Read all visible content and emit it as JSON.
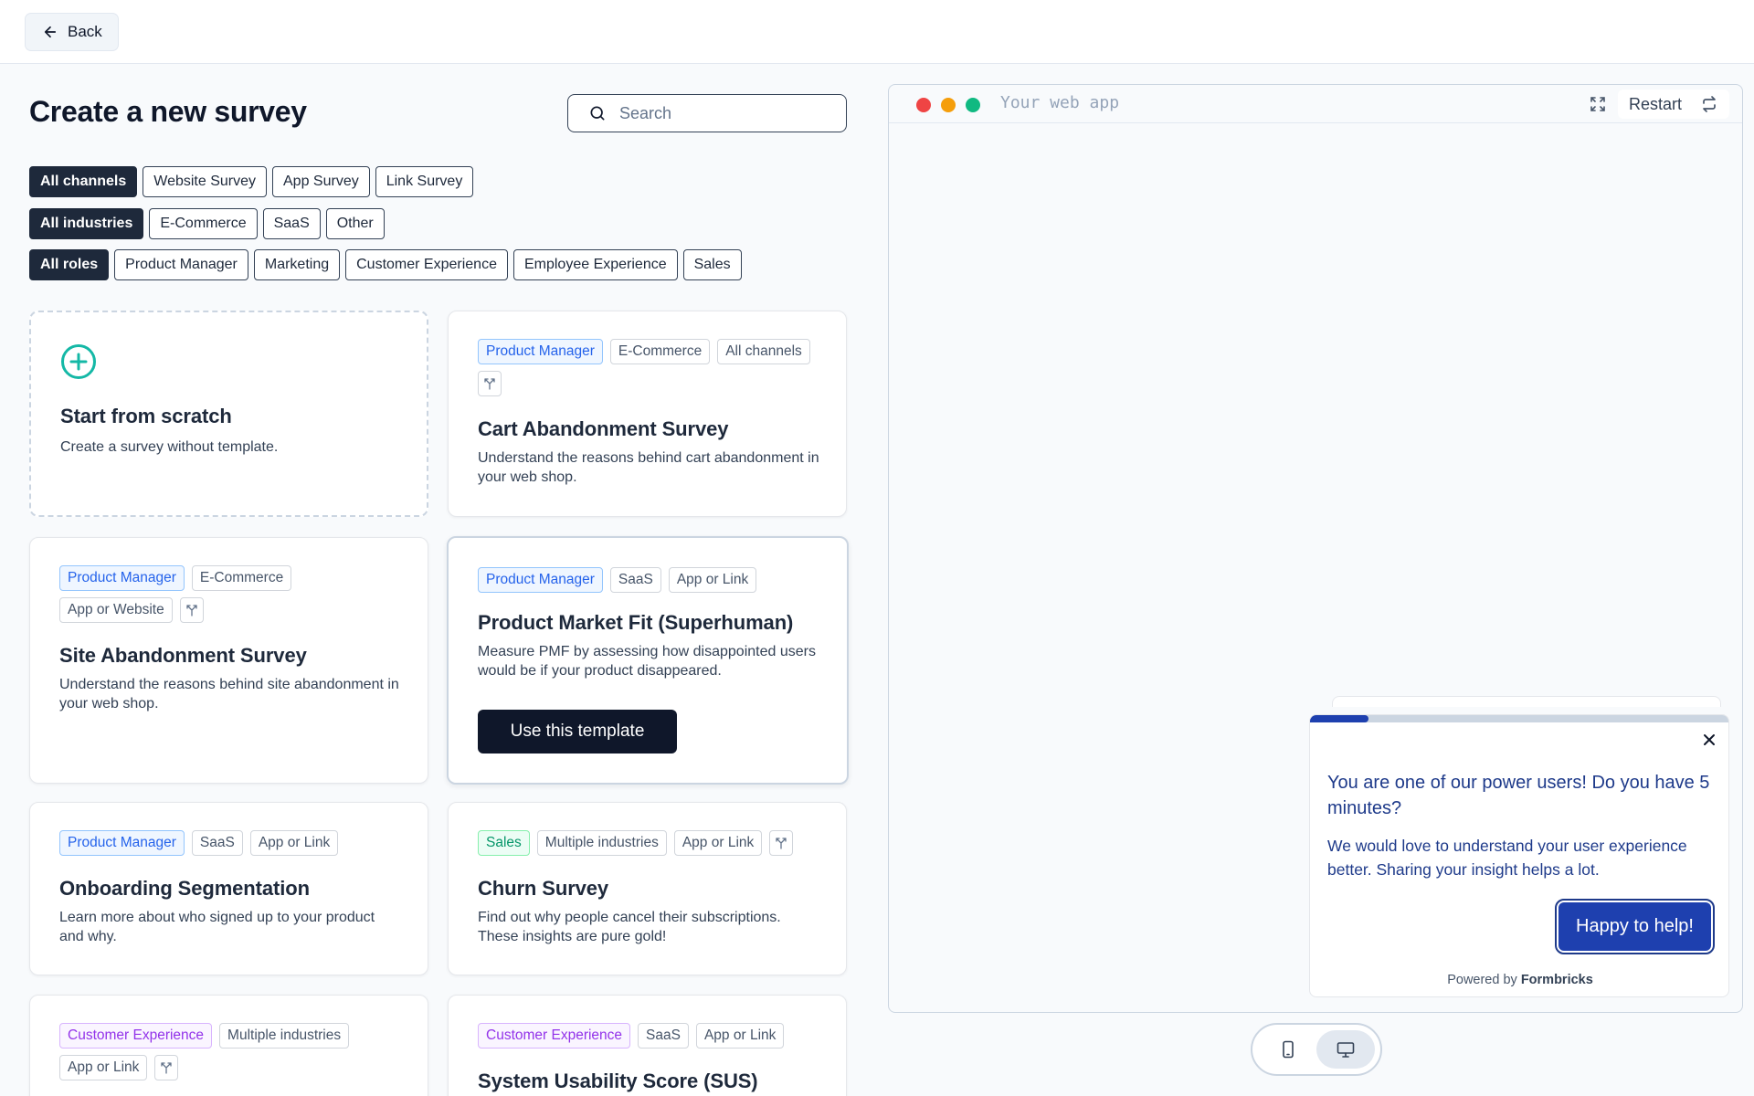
{
  "topbar": {
    "back_label": "Back"
  },
  "header": {
    "title": "Create a new survey",
    "search_placeholder": "Search"
  },
  "filters": {
    "channels": [
      "All channels",
      "Website Survey",
      "App Survey",
      "Link Survey"
    ],
    "industries": [
      "All industries",
      "E-Commerce",
      "SaaS",
      "Other"
    ],
    "roles": [
      "All roles",
      "Product Manager",
      "Marketing",
      "Customer Experience",
      "Employee Experience",
      "Sales"
    ]
  },
  "scratch": {
    "title": "Start from scratch",
    "description": "Create a survey without template."
  },
  "templates": [
    {
      "tags": [
        "Product Manager",
        "E-Commerce",
        "All channels"
      ],
      "title": "Cart Abandonment Survey",
      "description": "Understand the reasons behind cart abandonment in your web shop."
    },
    {
      "tags": [
        "Product Manager",
        "E-Commerce",
        "App or Website"
      ],
      "title": "Site Abandonment Survey",
      "description": "Understand the reasons behind site abandonment in your web shop."
    },
    {
      "tags": [
        "Product Manager",
        "SaaS",
        "App or Link"
      ],
      "title": "Product Market Fit (Superhuman)",
      "description": "Measure PMF by assessing how disappointed users would be if your product disappeared.",
      "button": "Use this template"
    },
    {
      "tags": [
        "Product Manager",
        "SaaS",
        "App or Link"
      ],
      "title": "Onboarding Segmentation",
      "description": "Learn more about who signed up to your product and why."
    },
    {
      "tags": [
        "Sales",
        "Multiple industries",
        "App or Link"
      ],
      "title": "Churn Survey",
      "description": "Find out why people cancel their subscriptions. These insights are pure gold!"
    },
    {
      "tags": [
        "Customer Experience",
        "Multiple industries",
        "App or Link"
      ]
    },
    {
      "tags": [
        "Customer Experience",
        "SaaS",
        "App or Link"
      ],
      "title": "System Usability Score (SUS)"
    }
  ],
  "preview": {
    "app_label": "Your web app",
    "restart_label": "Restart",
    "progress": 0.14,
    "survey": {
      "headline": "You are one of our power users! Do you have 5 minutes?",
      "subheader": "We would love to understand your user experience better. Sharing your insight helps a lot.",
      "button": "Happy to help!",
      "powered_prefix": "Powered by",
      "powered_brand": "Formbricks"
    }
  },
  "colors": {
    "accent": "#0f172a",
    "survey_brand": "#1e40af",
    "plus_icon": "#14b8a6"
  }
}
